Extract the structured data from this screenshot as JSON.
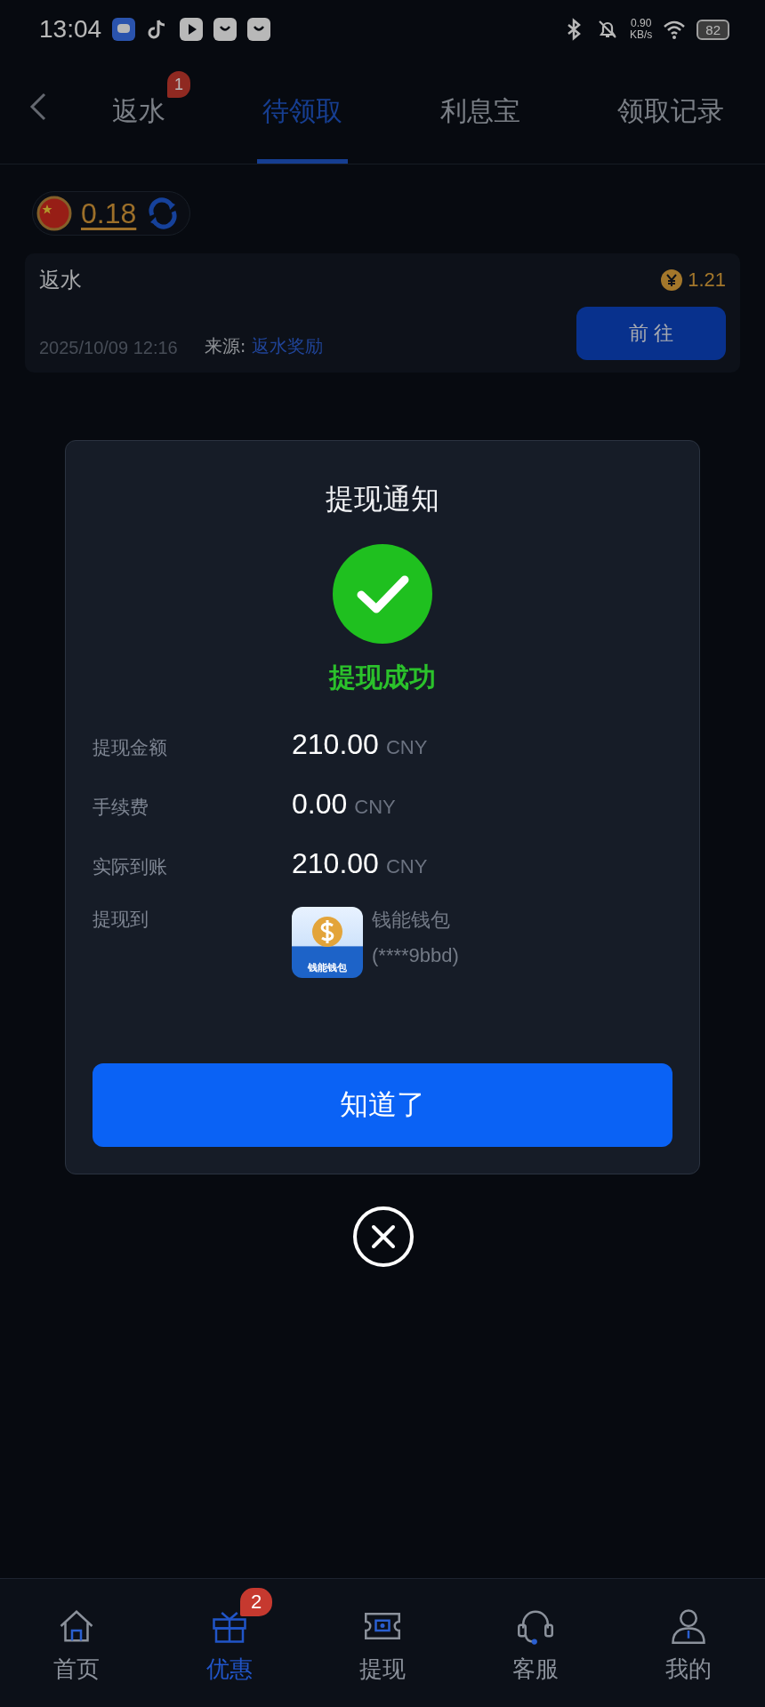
{
  "status_bar": {
    "time": "13:04",
    "net_speed": "0.90",
    "net_unit": "KB/s",
    "battery": "82"
  },
  "tabs": [
    {
      "label": "返水",
      "selected": false,
      "badge": "1"
    },
    {
      "label": "待领取",
      "selected": true
    },
    {
      "label": "利息宝",
      "selected": false
    },
    {
      "label": "领取记录",
      "selected": false
    }
  ],
  "balance": {
    "amount": "0.18"
  },
  "records": [
    {
      "title": "返水",
      "amount": "1.21",
      "time": "2025/10/09 12:16",
      "source_label": "来源:",
      "source": "返水奖励",
      "action": "前 往"
    }
  ],
  "dialog": {
    "title": "提现通知",
    "status": "提现成功",
    "rows": [
      {
        "label": "提现金额",
        "kind": "amount",
        "value": "210.00",
        "unit": "CNY"
      },
      {
        "label": "手续费",
        "kind": "amount",
        "value": "0.00",
        "unit": "CNY"
      },
      {
        "label": "实际到账",
        "kind": "amount",
        "value": "210.00",
        "unit": "CNY"
      },
      {
        "label": "提现到",
        "kind": "wallet",
        "wallet_name": "钱能钱包",
        "account": "(****9bbd)",
        "logo_text": "钱能钱包"
      }
    ],
    "button": "知道了"
  },
  "bottom_nav": [
    {
      "label": "首页",
      "selected": false
    },
    {
      "label": "优惠",
      "selected": true,
      "badge": "2"
    },
    {
      "label": "提现",
      "selected": false
    },
    {
      "label": "客服",
      "selected": false
    },
    {
      "label": "我的",
      "selected": false
    }
  ]
}
